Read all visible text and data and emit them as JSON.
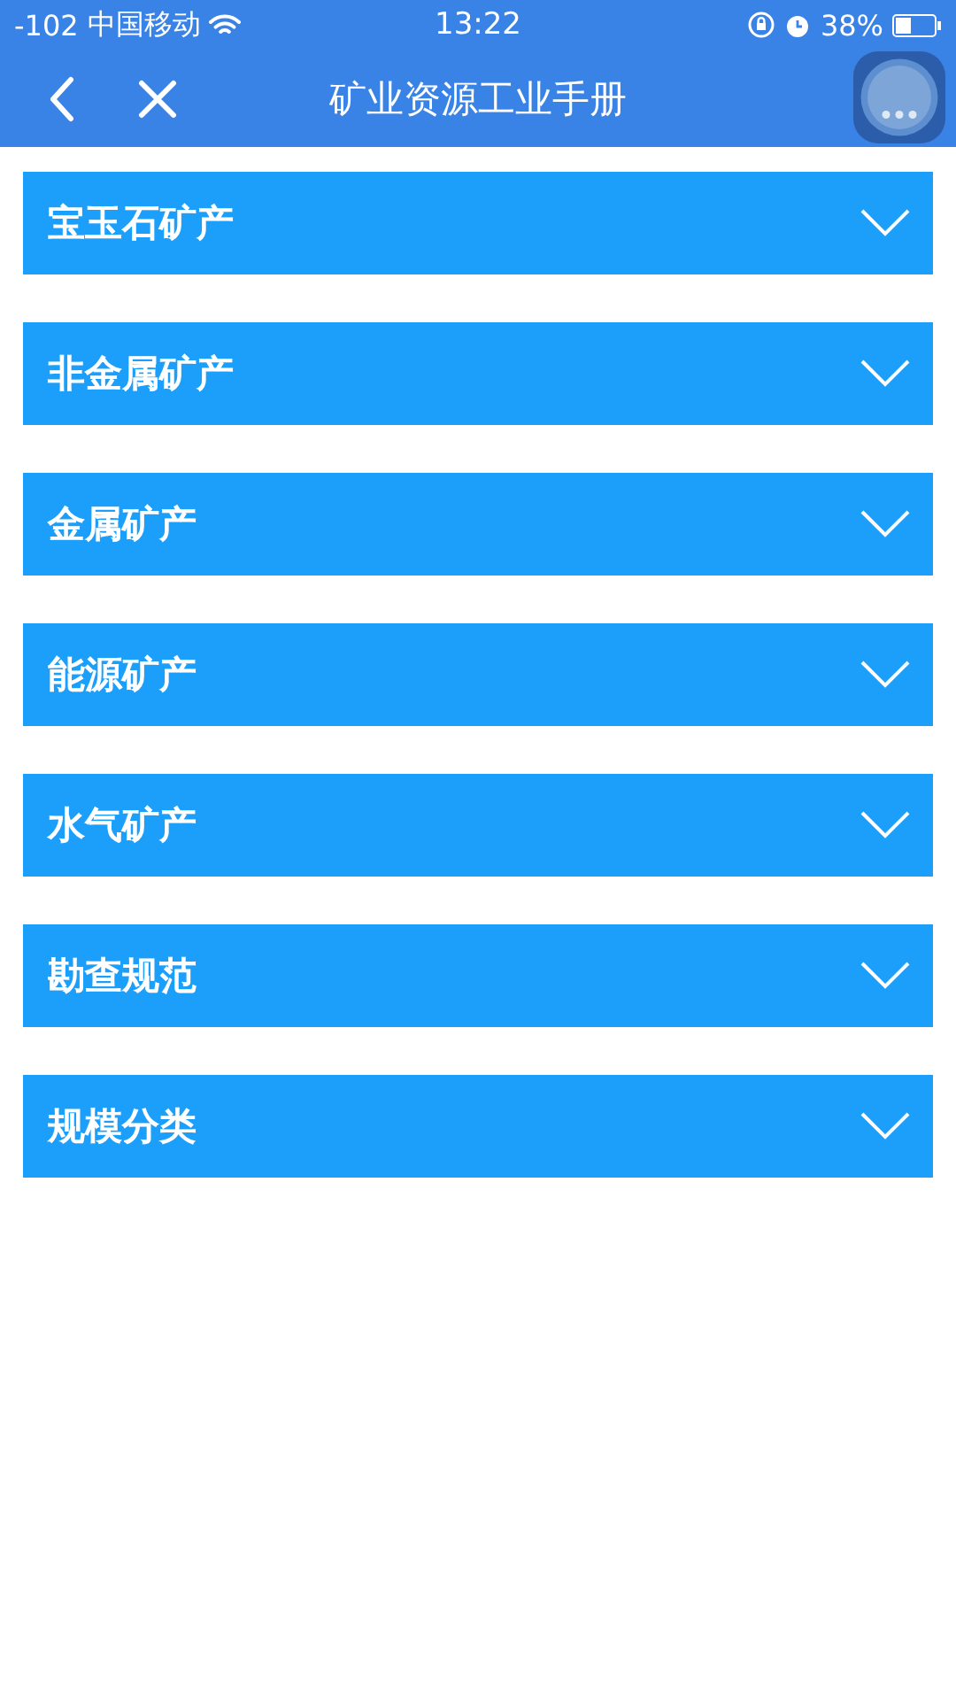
{
  "status_bar": {
    "signal": "-102",
    "carrier": "中国移动",
    "time": "13:22",
    "battery": "38%"
  },
  "nav_bar": {
    "title": "矿业资源工业手册"
  },
  "sections": [
    {
      "label": "宝玉石矿产",
      "expanded": false
    },
    {
      "label": "非金属矿产",
      "expanded": false
    },
    {
      "label": "金属矿产",
      "expanded": false
    },
    {
      "label": "能源矿产",
      "expanded": false
    },
    {
      "label": "水气矿产",
      "expanded": false
    },
    {
      "label": "勘查规范",
      "expanded": false
    },
    {
      "label": "规模分类",
      "expanded": false
    }
  ]
}
